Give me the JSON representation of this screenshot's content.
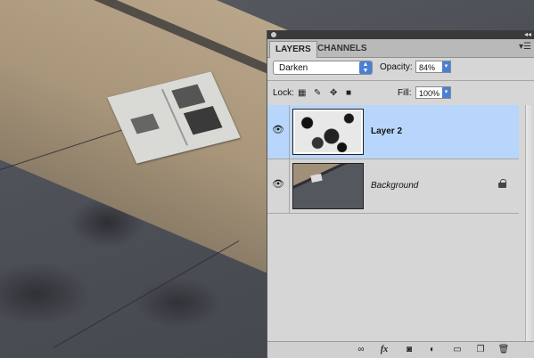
{
  "panel": {
    "tabs": [
      {
        "label": "LAYERS",
        "active": true
      },
      {
        "label": "CHANNELS",
        "active": false
      }
    ],
    "blend_mode": "Darken",
    "opacity_label": "Opacity:",
    "opacity_value": "84%",
    "lock_label": "Lock:",
    "fill_label": "Fill:",
    "fill_value": "100%",
    "layers": [
      {
        "name": "Layer 2",
        "selected": true,
        "visible": true,
        "locked": false
      },
      {
        "name": "Background",
        "selected": false,
        "visible": true,
        "locked": true
      }
    ],
    "footer_icons": [
      "link-icon",
      "fx-icon",
      "mask-icon",
      "adjustment-icon",
      "folder-icon",
      "new-layer-icon",
      "trash-icon"
    ],
    "fx_label": "fx"
  },
  "colors": {
    "selection": "#b8d6fb",
    "panel_bg": "#d6d6d6",
    "accent": "#4a7fd4"
  }
}
